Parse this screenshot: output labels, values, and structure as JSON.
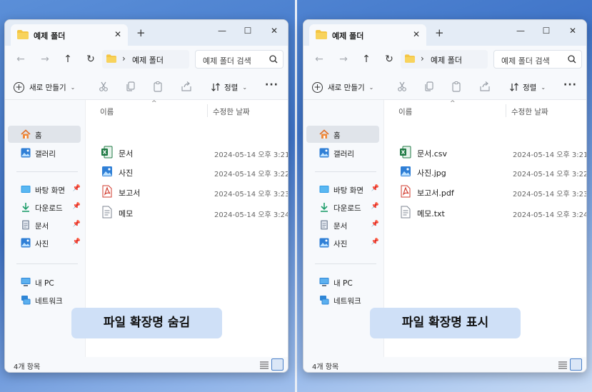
{
  "panels": [
    {
      "title": "예제 폴더",
      "tab_label": "예제 폴더",
      "path": "예제 폴더",
      "search_placeholder": "예제 폴더 검색",
      "new_label": "새로 만들기",
      "sort_label": "정렬",
      "columns": {
        "name": "이름",
        "date": "수정한 날짜"
      },
      "files": [
        {
          "name": "문서",
          "date": "2024-05-14 오후 3:21",
          "icon": "excel-icon"
        },
        {
          "name": "사진",
          "date": "2024-05-14 오후 3:22",
          "icon": "image-icon"
        },
        {
          "name": "보고서",
          "date": "2024-05-14 오후 3:23",
          "icon": "pdf-icon"
        },
        {
          "name": "메모",
          "date": "2024-05-14 오후 3:24",
          "icon": "text-file-icon"
        }
      ],
      "status": "4개 항목",
      "caption": "파일 확장명 숨김"
    },
    {
      "title": "예제 폴더",
      "tab_label": "예제 폴더",
      "path": "예제 폴더",
      "search_placeholder": "예제 폴더 검색",
      "new_label": "새로 만들기",
      "sort_label": "정렬",
      "columns": {
        "name": "이름",
        "date": "수정한 날짜"
      },
      "files": [
        {
          "name": "문서.csv",
          "date": "2024-05-14 오후 3:21",
          "icon": "excel-icon"
        },
        {
          "name": "사진.jpg",
          "date": "2024-05-14 오후 3:22",
          "icon": "image-icon"
        },
        {
          "name": "보고서.pdf",
          "date": "2024-05-14 오후 3:23",
          "icon": "pdf-icon"
        },
        {
          "name": "메모.txt",
          "date": "2024-05-14 오후 3:24",
          "icon": "text-file-icon"
        }
      ],
      "status": "4개 항목",
      "caption": "파일 확장명 표시"
    }
  ],
  "sidebar": {
    "items": [
      {
        "label": "홈",
        "icon": "home-icon"
      },
      {
        "label": "갤러리",
        "icon": "gallery-icon"
      },
      {
        "label": "바탕 화면",
        "icon": "desktop-icon",
        "pinned": true
      },
      {
        "label": "다운로드",
        "icon": "download-icon",
        "pinned": true
      },
      {
        "label": "문서",
        "icon": "documents-icon",
        "pinned": true
      },
      {
        "label": "사진",
        "icon": "pictures-icon",
        "pinned": true
      },
      {
        "label": "내 PC",
        "icon": "pc-icon"
      },
      {
        "label": "네트워크",
        "icon": "network-icon"
      }
    ]
  },
  "colors": {
    "accent": "#4a80c8",
    "caption_bg": "#cfe0f7",
    "folder": "#f4c542",
    "excel": "#1f7a44",
    "pdf": "#d23b2e",
    "image": "#2f7fd6"
  }
}
